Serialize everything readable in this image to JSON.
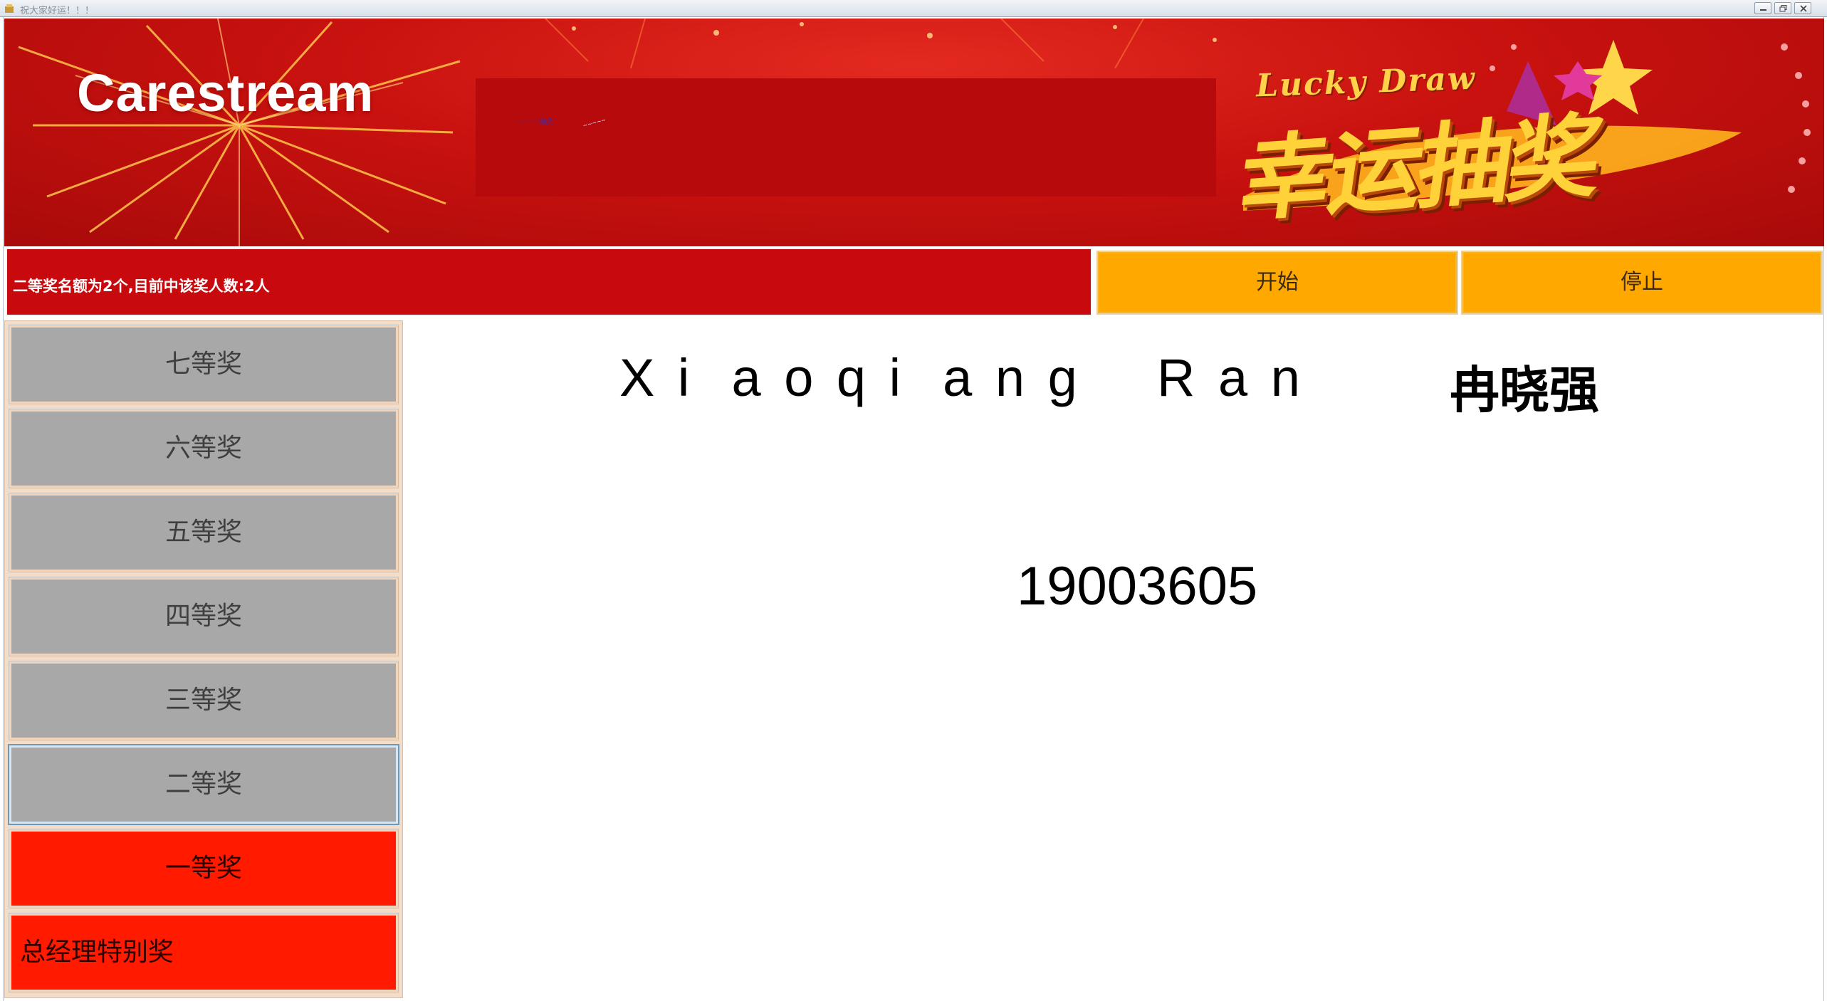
{
  "window": {
    "title": "祝大家好运！！！",
    "app_icon": "app-icon",
    "controls": [
      "minimize-icon",
      "restore-icon",
      "close-icon"
    ]
  },
  "banner": {
    "brand": "Carestream",
    "lucky_draw": "Lucky Draw",
    "lucky_draw_cn": "幸运抽奖",
    "tiny_text": "~~~~抽奖",
    "tiny_text2": "~~~~~"
  },
  "status": {
    "message": "二等奖名额为2个,目前中该奖人数:2人"
  },
  "controls": {
    "start_label": "开始",
    "stop_label": "停止"
  },
  "prizes": [
    {
      "label": "七等奖",
      "style": "gray"
    },
    {
      "label": "六等奖",
      "style": "gray"
    },
    {
      "label": "五等奖",
      "style": "gray"
    },
    {
      "label": "四等奖",
      "style": "gray"
    },
    {
      "label": "三等奖",
      "style": "gray"
    },
    {
      "label": "二等奖",
      "style": "gray",
      "selected": true
    },
    {
      "label": "一等奖",
      "style": "red"
    },
    {
      "label": "总经理特别奖",
      "style": "red"
    }
  ],
  "result": {
    "name_en": "X i  a o q i  a n g    R a n",
    "name_cn": "冉晓强",
    "employee_id": "19003605"
  },
  "colors": {
    "banner_red": "#c9120f",
    "status_red": "#c8090d",
    "button_orange": "#ffa800",
    "prize_gray": "#a8a8a8",
    "prize_red": "#ff1a00",
    "panel_peach": "#f4ddc8"
  }
}
